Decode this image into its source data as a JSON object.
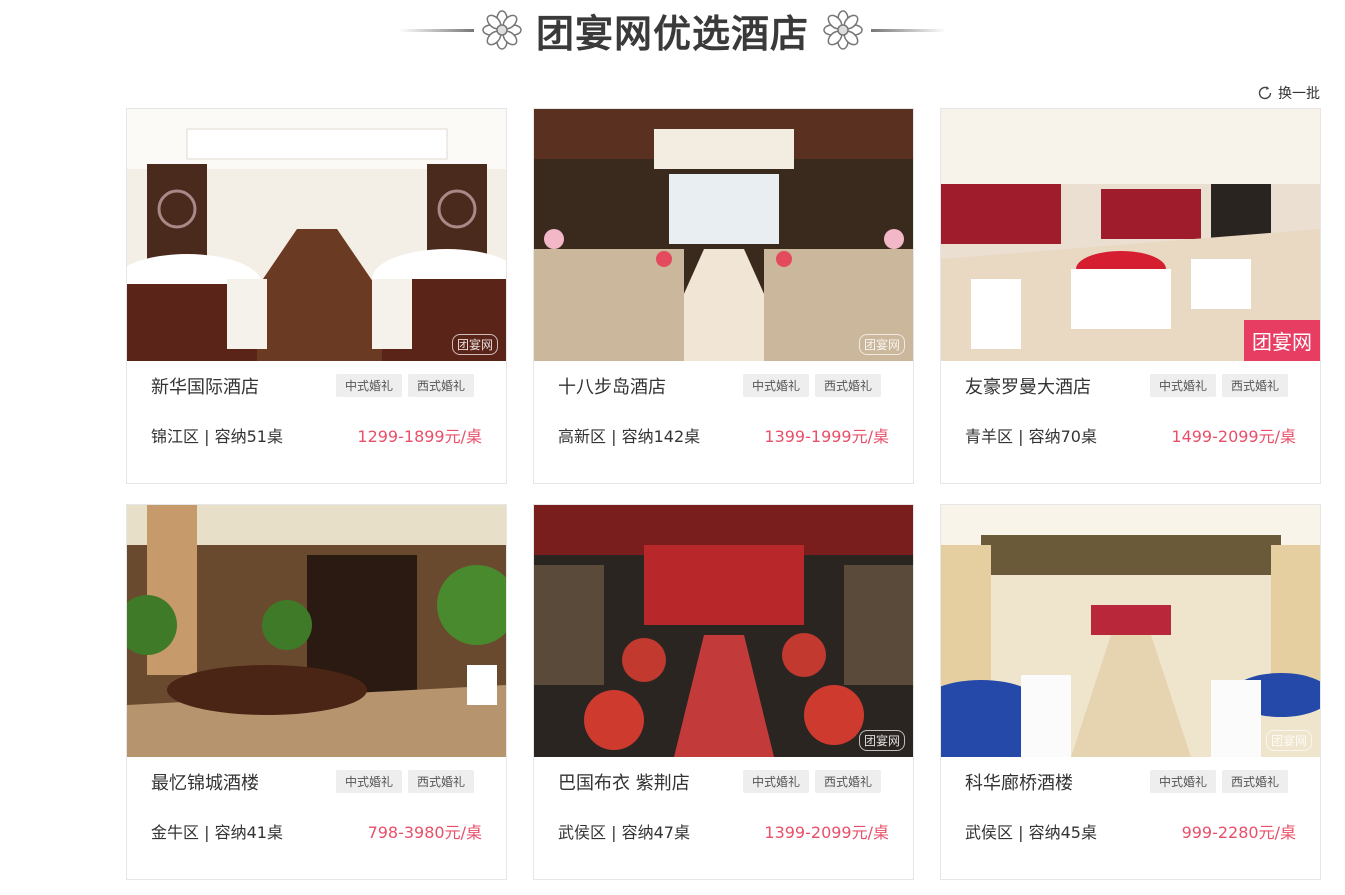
{
  "page": {
    "title": "团宴网优选酒店",
    "refresh_label": "换一批",
    "watermark": "团宴网",
    "accent_color": "#e8506a"
  },
  "hotels": [
    {
      "name": "新华国际酒店",
      "tags": [
        "中式婚礼",
        "西式婚礼"
      ],
      "district": "锦江区",
      "capacity": "容纳51桌",
      "price": "1299-1899元/桌"
    },
    {
      "name": "十八步岛酒店",
      "tags": [
        "中式婚礼",
        "西式婚礼"
      ],
      "district": "高新区",
      "capacity": "容纳142桌",
      "price": "1399-1999元/桌"
    },
    {
      "name": "友豪罗曼大酒店",
      "tags": [
        "中式婚礼",
        "西式婚礼"
      ],
      "district": "青羊区",
      "capacity": "容纳70桌",
      "price": "1499-2099元/桌"
    },
    {
      "name": "最忆锦城酒楼",
      "tags": [
        "中式婚礼",
        "西式婚礼"
      ],
      "district": "金牛区",
      "capacity": "容纳41桌",
      "price": "798-3980元/桌"
    },
    {
      "name": "巴国布衣 紫荆店",
      "tags": [
        "中式婚礼",
        "西式婚礼"
      ],
      "district": "武侯区",
      "capacity": "容纳47桌",
      "price": "1399-2099元/桌"
    },
    {
      "name": "科华廊桥酒楼",
      "tags": [
        "中式婚礼",
        "西式婚礼"
      ],
      "district": "武侯区",
      "capacity": "容纳45桌",
      "price": "999-2280元/桌"
    }
  ]
}
